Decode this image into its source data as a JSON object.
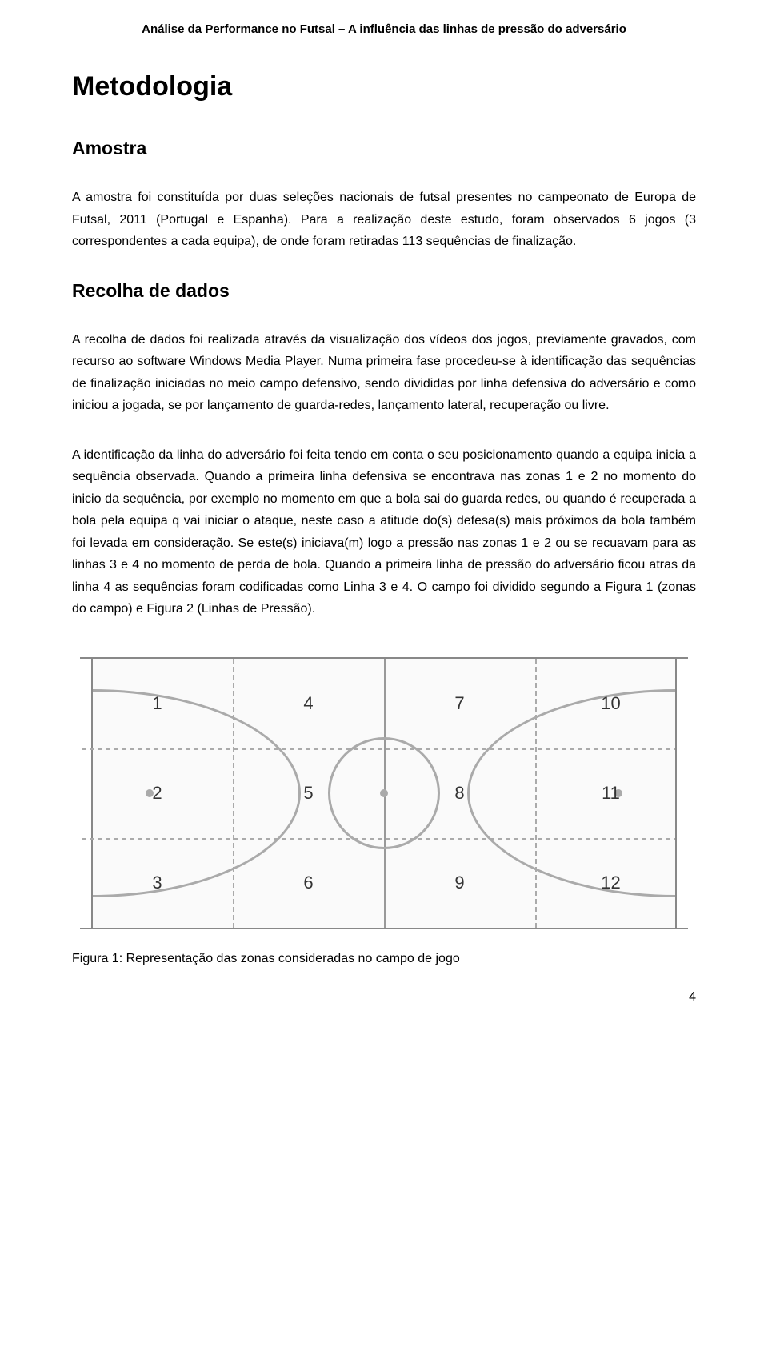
{
  "header": "Análise da Performance no Futsal – A influência das linhas de pressão do adversário",
  "title": "Metodologia",
  "section1_heading": "Amostra",
  "section1_body": "A amostra foi constituída por duas seleções nacionais de futsal presentes no campeonato de Europa de Futsal, 2011 (Portugal e Espanha). Para a realização deste estudo, foram observados 6 jogos (3 correspondentes a cada equipa), de onde foram retiradas 113 sequências de finalização.",
  "section2_heading": "Recolha de dados",
  "section2_para1": "A recolha de dados foi realizada através da visualização dos vídeos dos jogos, previamente gravados, com recurso ao software Windows Media Player. Numa primeira fase procedeu-se à identificação das sequências de finalização iniciadas no meio campo defensivo, sendo divididas por linha defensiva do adversário e como iniciou a jogada, se por lançamento de guarda-redes, lançamento lateral, recuperação ou livre.",
  "section2_para2": "A identificação da linha do adversário foi feita tendo em conta o seu posicionamento quando a equipa inicia a sequência observada. Quando a primeira linha defensiva se encontrava nas zonas 1 e 2 no momento do inicio da sequência, por exemplo no momento em que a bola sai do guarda redes, ou quando é recuperada a bola pela equipa q vai iniciar o ataque, neste caso a atitude do(s) defesa(s) mais próximos da bola também foi levada em consideração. Se este(s) iniciava(m) logo a pressão nas zonas 1 e 2 ou se recuavam para as linhas 3 e 4 no momento de perda de bola. Quando a primeira linha de pressão do adversário ficou atras da linha 4 as sequências foram codificadas como Linha 3 e 4. O campo foi dividido segundo a Figura 1 (zonas do campo) e Figura 2 (Linhas de Pressão).",
  "figure_caption": "Figura 1: Representação das zonas consideradas no campo de jogo",
  "page_number": "4",
  "zones": {
    "z1": "1",
    "z4": "4",
    "z7": "7",
    "z10": "10",
    "z2": "2",
    "z5": "5",
    "z8": "8",
    "z11": "11",
    "z3": "3",
    "z6": "6",
    "z9": "9",
    "z12": "12"
  }
}
